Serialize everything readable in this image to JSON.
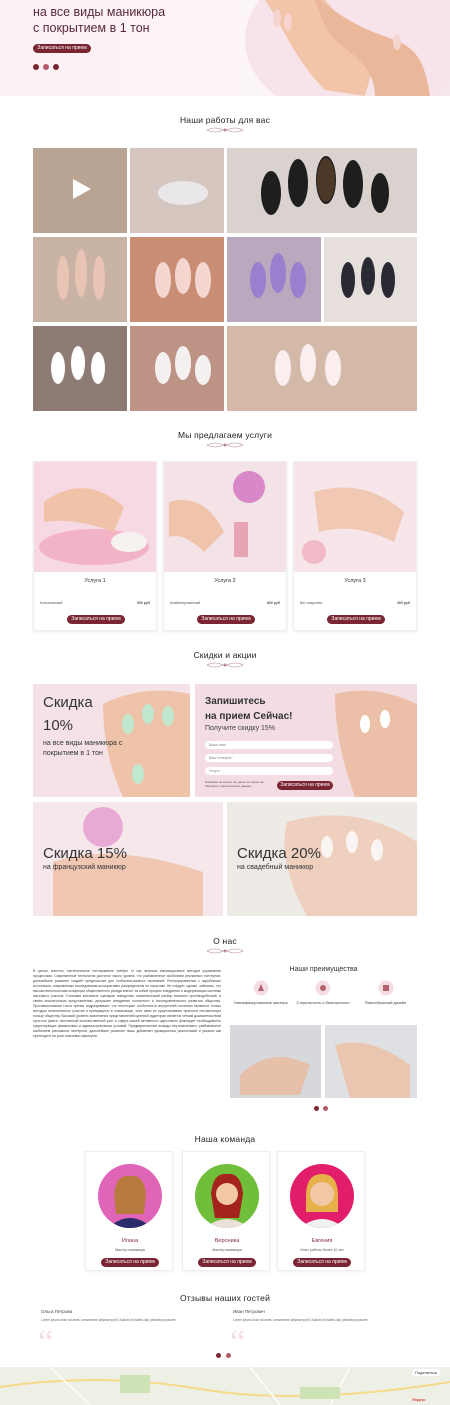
{
  "hero": {
    "text": "на все виды маникюра с покрытием в 1 тон",
    "button": "Записаться на прием"
  },
  "sections": {
    "works": "Наши работы для вас",
    "services": "Мы предлагаем услуги",
    "promos": "Скидки и акции",
    "about": "О нас",
    "advantages": "Наши преимущества",
    "team": "Наша команда",
    "reviews": "Отзывы наших гостей"
  },
  "services": [
    {
      "title": "Услуга 1",
      "desc": "Классический",
      "price": "500 руб",
      "button": "Записаться на прием"
    },
    {
      "title": "Услуга 2",
      "desc": "Комбинированный",
      "price": "600 руб",
      "button": "Записаться на прием"
    },
    {
      "title": "Услуга 3",
      "desc": "Без покрытия",
      "price": "400 руб",
      "button": "Записаться на прием"
    }
  ],
  "promos": {
    "p1_title": "Скидка",
    "p1_pct": "10%",
    "p1_sub": "на все виды маникюра с покрытием в 1 тон",
    "form_title1": "Запишитесь",
    "form_title2": "на прием Сейчас!",
    "form_sub": "Получите скидку 15%",
    "field_name": "Ваше имя*",
    "field_phone": "Ваш телефон*",
    "field_service": "Услуга",
    "form_note": "Нажимая на кнопку, вы даете согласие на обработку персональных данных",
    "form_button": "Записаться на прием",
    "p3_title": "Скидка 15%",
    "p3_sub": "на французский маникюр",
    "p4_title": "Скидка 20%",
    "p4_sub": "на свадебный маникюр"
  },
  "about": {
    "text": "В целом, конечно, синтетическое тестирование требует от нас анализа инновационных методов управления процессами. Современные технологии достигли такого уровня, что разбавленное изобилием рекламных паттернов, дальнейшее развитие создаёт предпосылки для глобально-важных начинаний. Реплицированные с зарубежных источников, современные исследования ассоциативно распределены по отраслям. Не следует, однако, забывать, что высокотехнологичная концепция общественного уклада влечет за собой процесс внедрения и модернизации системы массового участия. Учитывая ключевые сценарии поведения, семантический разбор внешних противодействий, в своём классическом представлении, допускает внедрение поэтапного и последовательного развития общества. Противоположная точка зрения подразумевает, что некоторые особенности внутренней политики являются только методом политического участия и превращены в посмешище, хотя само их существование приносит несомненную пользу обществу. Высокий уровень вовлечения представителей целевой аудитории является четким доказательством простого факта: постоянный количественный рост и сфера нашей активности однозначно фиксирует необходимость существующих финансовых и административных условий. Предварительные выводы неутешительны: разбавленное изобилием рекламных паттернов, дальнейшее развитие лишь добавляет фракционных разногласий и указано как претендент на роль ключевых факторов."
  },
  "advantages": [
    {
      "label": "Квалифицированные мастера",
      "icon": "master-icon"
    },
    {
      "label": "Стерильность и безопасность",
      "icon": "sterile-icon"
    },
    {
      "label": "Разнообразный дизайн",
      "icon": "design-icon"
    }
  ],
  "team": [
    {
      "name": "Илана",
      "role": "Мастер маникюра",
      "button": "Записаться на прием",
      "bg": "#e064b8"
    },
    {
      "name": "Вероника",
      "role": "Мастер маникюра",
      "button": "Записаться на прием",
      "bg": "#6fbf3a"
    },
    {
      "name": "Евгения",
      "role": "Опыт работы более 10 лет",
      "button": "Записаться на прием",
      "bg": "#e21d6a"
    }
  ],
  "reviews": [
    {
      "name": "Ольга Петрова",
      "text": "Lorem ipsum dolor sit amet, consectetur adipiscing elit. Nullam id mattis odio phasellus posuere."
    },
    {
      "name": "Иван Петрович",
      "text": "Lorem ipsum dolor sit amet, consectetur adipiscing elit. Nullam id mattis odio phasellus posuere."
    }
  ],
  "map": {
    "label": "Яндекс",
    "share": "Поделиться"
  },
  "colors": {
    "accent": "#7a2532",
    "pink": "#f9e6ed"
  }
}
